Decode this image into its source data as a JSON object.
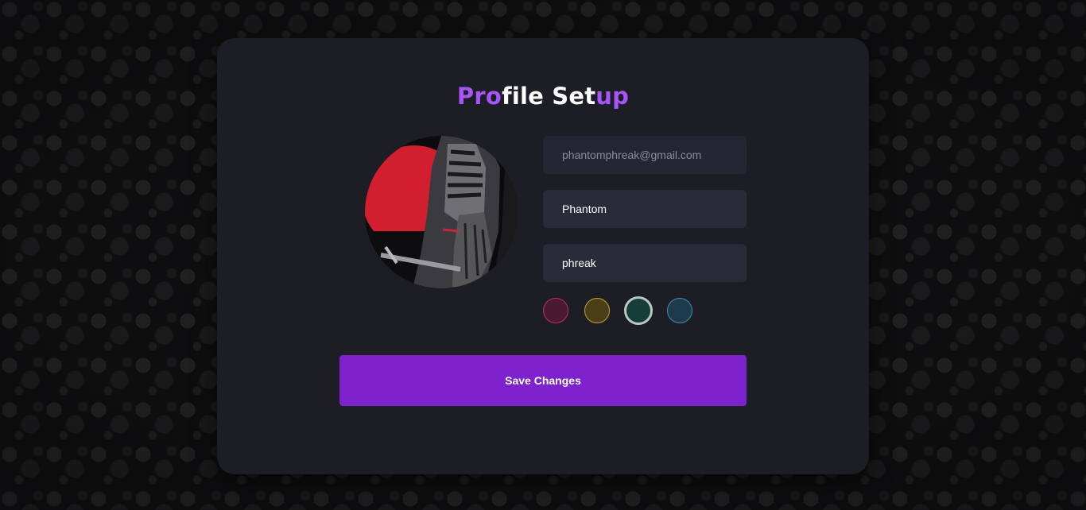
{
  "profile": {
    "title_parts": [
      "Pro",
      "file Set",
      "up"
    ],
    "email_placeholder": "phantomphreak@gmail.com",
    "first_name": "Phantom",
    "last_name": "phreak",
    "save_label": "Save Changes"
  },
  "swatches": [
    {
      "name": "crimson",
      "fill": "#4a1a33",
      "border": "#c0305f",
      "selected": false
    },
    {
      "name": "gold",
      "fill": "#4a3e17",
      "border": "#c9a227",
      "selected": false
    },
    {
      "name": "teal",
      "fill": "#163d38",
      "border": "#b7c7c2",
      "selected": true
    },
    {
      "name": "steel-blue",
      "fill": "#1e3a4d",
      "border": "#4a8bb0",
      "selected": false
    }
  ],
  "colors": {
    "accent": "#a855f7",
    "button": "#7e22ce",
    "card": "#1d1d26",
    "input": "#2a2b38"
  }
}
